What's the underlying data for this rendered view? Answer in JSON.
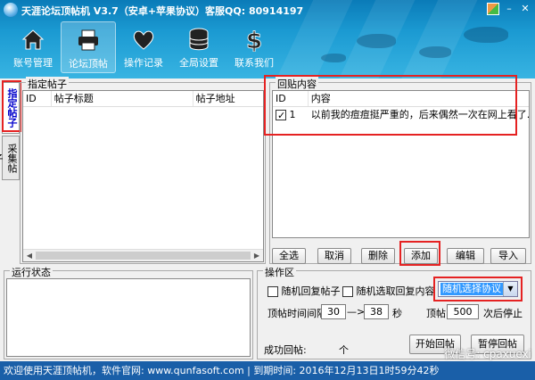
{
  "window": {
    "title": "天涯论坛顶帖机 V3.7（安卓+苹果协议）客服QQ: 80914197",
    "controls": {
      "flag_icon": "flag-icon",
      "minimize": "–",
      "close": "✕"
    }
  },
  "nav": [
    {
      "label": "账号管理",
      "icon": "home-icon"
    },
    {
      "label": "论坛顶帖",
      "icon": "printer-icon",
      "active": true
    },
    {
      "label": "操作记录",
      "icon": "heart-icon"
    },
    {
      "label": "全局设置",
      "icon": "database-icon"
    },
    {
      "label": "联系我们",
      "icon": "dollar-icon"
    }
  ],
  "side_tabs": [
    "指定帖子",
    "采集帖子"
  ],
  "posts_panel": {
    "legend": "指定帖子",
    "columns": [
      "ID",
      "帖子标题",
      "帖子地址"
    ]
  },
  "reply_panel": {
    "legend": "回贴内容",
    "columns": [
      "ID",
      "内容"
    ],
    "rows": [
      {
        "id": "1",
        "checked": true,
        "content": "以前我的痘痘挺严重的，后来偶然一次在网上看了..."
      }
    ]
  },
  "reply_buttons": {
    "select_all": "全选",
    "cancel": "取消",
    "delete": "删除",
    "add": "添加",
    "edit": "编辑",
    "import": "导入"
  },
  "run_status": {
    "legend": "运行状态"
  },
  "ops": {
    "legend": "操作区",
    "random_reply_post": "随机回复帖子",
    "random_reply_content": "随机选取回复内容",
    "protocol_select": "随机选择协议",
    "interval_label": "顶帖时间间隔",
    "interval_from": "30",
    "arrow": "—>",
    "interval_to": "38",
    "seconds": "秒",
    "post_label": "顶帖",
    "post_count": "500",
    "stop_after": "次后停止",
    "success_label": "成功回帖:",
    "success_unit": "个",
    "start_button": "开始回帖",
    "pause_button": "暂停回帖"
  },
  "status_bar": {
    "text": "欢迎使用天涯顶帖机，软件官网: www.qunfasoft.com  |  到期时间: 2016年12月13日1时59分42秒"
  },
  "watermark": "微信号: cpaxuexi",
  "colors": {
    "accent": "#1a5fa8",
    "highlight": "#e52222",
    "selection": "#3399ff"
  }
}
